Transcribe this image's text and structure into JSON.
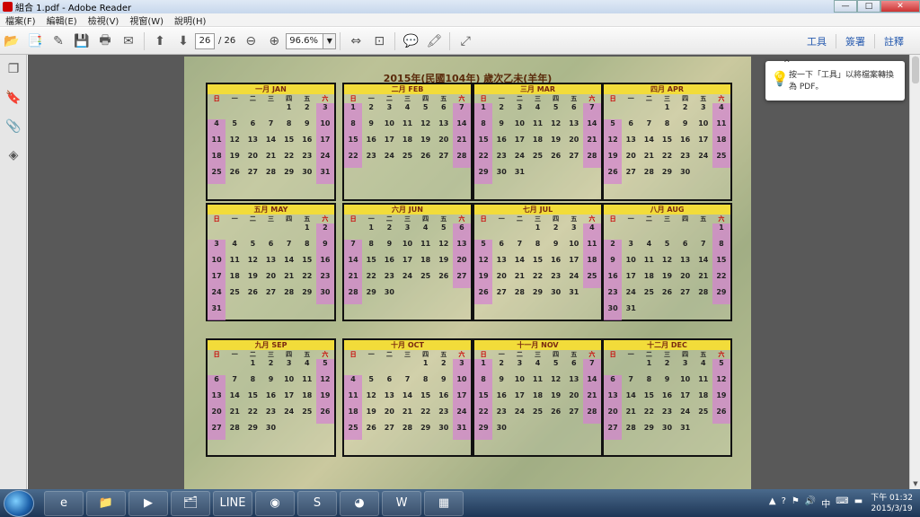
{
  "window": {
    "title": "組合 1.pdf - Adobe Reader",
    "min": "—",
    "max": "□",
    "close": "✕"
  },
  "menu": [
    "檔案(F)",
    "編輯(E)",
    "檢視(V)",
    "視窗(W)",
    "說明(H)"
  ],
  "toolbar": {
    "page": "26",
    "total": "/ 26",
    "zoom": "96.6%",
    "links": [
      "工具",
      "簽署",
      "註釋"
    ]
  },
  "tip": {
    "text": "按一下「工具」以將檔案轉換為 PDF。"
  },
  "calendar": {
    "title": "2015年(民國104年) 歲次乙未(羊年)",
    "weekdays": [
      "日",
      "一",
      "二",
      "三",
      "四",
      "五",
      "六"
    ],
    "months": [
      {
        "name": "一月 JAN",
        "rows": [
          [
            "",
            "",
            "",
            "",
            "1",
            "2",
            "3"
          ],
          [
            "4",
            "5",
            "6",
            "7",
            "8",
            "9",
            "10"
          ],
          [
            "11",
            "12",
            "13",
            "14",
            "15",
            "16",
            "17"
          ],
          [
            "18",
            "19",
            "20",
            "21",
            "22",
            "23",
            "24"
          ],
          [
            "25",
            "26",
            "27",
            "28",
            "29",
            "30",
            "31"
          ]
        ]
      },
      {
        "name": "二月 FEB",
        "rows": [
          [
            "1",
            "2",
            "3",
            "4",
            "5",
            "6",
            "7"
          ],
          [
            "8",
            "9",
            "10",
            "11",
            "12",
            "13",
            "14"
          ],
          [
            "15",
            "16",
            "17",
            "18",
            "19",
            "20",
            "21"
          ],
          [
            "22",
            "23",
            "24",
            "25",
            "26",
            "27",
            "28"
          ],
          [
            "",
            "",
            "",
            "",
            "",
            "",
            ""
          ]
        ]
      },
      {
        "name": "三月 MAR",
        "rows": [
          [
            "1",
            "2",
            "3",
            "4",
            "5",
            "6",
            "7"
          ],
          [
            "8",
            "9",
            "10",
            "11",
            "12",
            "13",
            "14"
          ],
          [
            "15",
            "16",
            "17",
            "18",
            "19",
            "20",
            "21"
          ],
          [
            "22",
            "23",
            "24",
            "25",
            "26",
            "27",
            "28"
          ],
          [
            "29",
            "30",
            "31",
            "",
            "",
            "",
            ""
          ]
        ]
      },
      {
        "name": "四月 APR",
        "rows": [
          [
            "",
            "",
            "",
            "1",
            "2",
            "3",
            "4"
          ],
          [
            "5",
            "6",
            "7",
            "8",
            "9",
            "10",
            "11"
          ],
          [
            "12",
            "13",
            "14",
            "15",
            "16",
            "17",
            "18"
          ],
          [
            "19",
            "20",
            "21",
            "22",
            "23",
            "24",
            "25"
          ],
          [
            "26",
            "27",
            "28",
            "29",
            "30",
            "",
            ""
          ]
        ]
      },
      {
        "name": "五月 MAY",
        "rows": [
          [
            "",
            "",
            "",
            "",
            "",
            "1",
            "2"
          ],
          [
            "3",
            "4",
            "5",
            "6",
            "7",
            "8",
            "9"
          ],
          [
            "10",
            "11",
            "12",
            "13",
            "14",
            "15",
            "16"
          ],
          [
            "17",
            "18",
            "19",
            "20",
            "21",
            "22",
            "23"
          ],
          [
            "24",
            "25",
            "26",
            "27",
            "28",
            "29",
            "30"
          ],
          [
            "31",
            "",
            "",
            "",
            "",
            "",
            ""
          ]
        ]
      },
      {
        "name": "六月 JUN",
        "rows": [
          [
            "",
            "1",
            "2",
            "3",
            "4",
            "5",
            "6"
          ],
          [
            "7",
            "8",
            "9",
            "10",
            "11",
            "12",
            "13"
          ],
          [
            "14",
            "15",
            "16",
            "17",
            "18",
            "19",
            "20"
          ],
          [
            "21",
            "22",
            "23",
            "24",
            "25",
            "26",
            "27"
          ],
          [
            "28",
            "29",
            "30",
            "",
            "",
            "",
            ""
          ]
        ]
      },
      {
        "name": "七月 JUL",
        "rows": [
          [
            "",
            "",
            "",
            "1",
            "2",
            "3",
            "4"
          ],
          [
            "5",
            "6",
            "7",
            "8",
            "9",
            "10",
            "11"
          ],
          [
            "12",
            "13",
            "14",
            "15",
            "16",
            "17",
            "18"
          ],
          [
            "19",
            "20",
            "21",
            "22",
            "23",
            "24",
            "25"
          ],
          [
            "26",
            "27",
            "28",
            "29",
            "30",
            "31",
            ""
          ]
        ]
      },
      {
        "name": "八月 AUG",
        "rows": [
          [
            "",
            "",
            "",
            "",
            "",
            "",
            "1"
          ],
          [
            "2",
            "3",
            "4",
            "5",
            "6",
            "7",
            "8"
          ],
          [
            "9",
            "10",
            "11",
            "12",
            "13",
            "14",
            "15"
          ],
          [
            "16",
            "17",
            "18",
            "19",
            "20",
            "21",
            "22"
          ],
          [
            "23",
            "24",
            "25",
            "26",
            "27",
            "28",
            "29"
          ],
          [
            "30",
            "31",
            "",
            "",
            "",
            "",
            ""
          ]
        ]
      },
      {
        "name": "九月 SEP",
        "rows": [
          [
            "",
            "",
            "1",
            "2",
            "3",
            "4",
            "5"
          ],
          [
            "6",
            "7",
            "8",
            "9",
            "10",
            "11",
            "12"
          ],
          [
            "13",
            "14",
            "15",
            "16",
            "17",
            "18",
            "19"
          ],
          [
            "20",
            "21",
            "22",
            "23",
            "24",
            "25",
            "26"
          ],
          [
            "27",
            "28",
            "29",
            "30",
            "",
            "",
            ""
          ]
        ]
      },
      {
        "name": "十月 OCT",
        "rows": [
          [
            "",
            "",
            "",
            "",
            "1",
            "2",
            "3"
          ],
          [
            "4",
            "5",
            "6",
            "7",
            "8",
            "9",
            "10"
          ],
          [
            "11",
            "12",
            "13",
            "14",
            "15",
            "16",
            "17"
          ],
          [
            "18",
            "19",
            "20",
            "21",
            "22",
            "23",
            "24"
          ],
          [
            "25",
            "26",
            "27",
            "28",
            "29",
            "30",
            "31"
          ]
        ]
      },
      {
        "name": "十一月 NOV",
        "rows": [
          [
            "1",
            "2",
            "3",
            "4",
            "5",
            "6",
            "7"
          ],
          [
            "8",
            "9",
            "10",
            "11",
            "12",
            "13",
            "14"
          ],
          [
            "15",
            "16",
            "17",
            "18",
            "19",
            "20",
            "21"
          ],
          [
            "22",
            "23",
            "24",
            "25",
            "26",
            "27",
            "28"
          ],
          [
            "29",
            "30",
            "",
            "",
            "",
            "",
            ""
          ]
        ]
      },
      {
        "name": "十二月 DEC",
        "rows": [
          [
            "",
            "",
            "1",
            "2",
            "3",
            "4",
            "5"
          ],
          [
            "6",
            "7",
            "8",
            "9",
            "10",
            "11",
            "12"
          ],
          [
            "13",
            "14",
            "15",
            "16",
            "17",
            "18",
            "19"
          ],
          [
            "20",
            "21",
            "22",
            "23",
            "24",
            "25",
            "26"
          ],
          [
            "27",
            "28",
            "29",
            "30",
            "31",
            "",
            ""
          ]
        ]
      }
    ]
  },
  "taskbar": {
    "clock_time": "下午 01:32",
    "clock_date": "2015/3/19",
    "apps": [
      "e",
      "📁",
      "▶",
      "🗂",
      "LINE",
      "◉",
      "S",
      "◕",
      "W",
      "▦"
    ],
    "tray": [
      "▲",
      "?",
      "⚑",
      "🔊",
      "中",
      "⌨",
      "▬"
    ]
  }
}
